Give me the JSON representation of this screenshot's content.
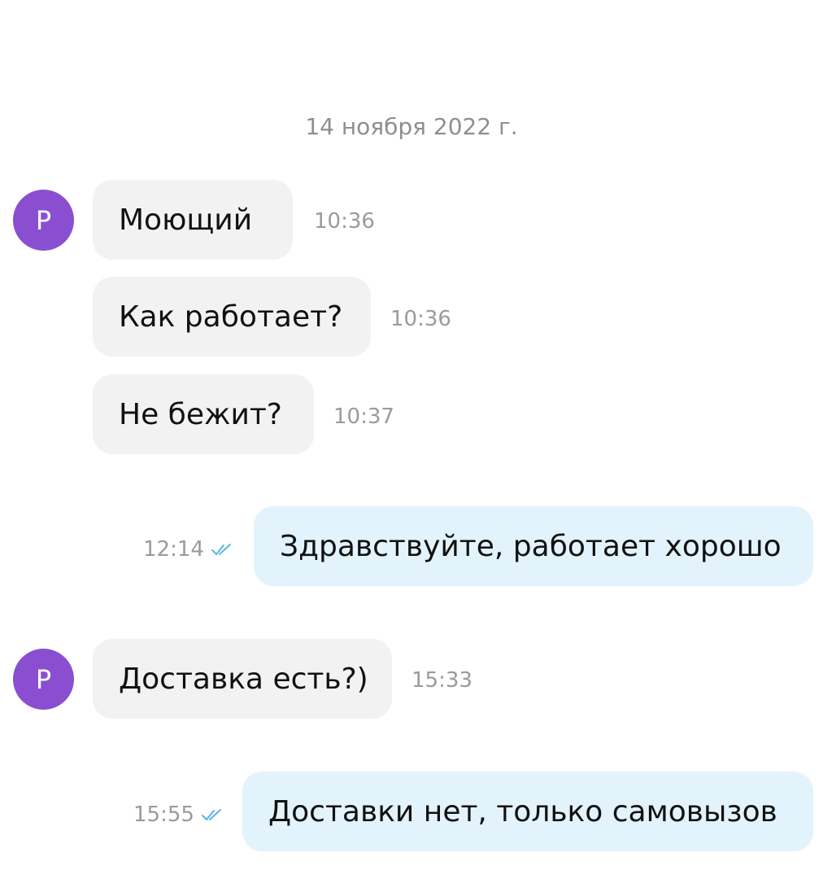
{
  "chat": {
    "date_separator": "14 ноября 2022 г.",
    "colors": {
      "avatar": "#8a4fd0",
      "incoming_bubble": "#f2f2f2",
      "outgoing_bubble": "#e3f3fb",
      "read_check": "#5ab4e5",
      "timestamp": "#9a9a9f"
    },
    "messages": [
      {
        "direction": "incoming",
        "avatar_letter": "P",
        "text": "Моющий",
        "time": "10:36"
      },
      {
        "direction": "incoming",
        "text": "Как работает?",
        "time": "10:36"
      },
      {
        "direction": "incoming",
        "text": "Не бежит?",
        "time": "10:37"
      },
      {
        "direction": "outgoing",
        "text": "Здравствуйте, работает хорошо",
        "time": "12:14",
        "status_icon": "double-check-icon"
      },
      {
        "direction": "incoming",
        "avatar_letter": "P",
        "text": "Доставка есть?)",
        "time": "15:33"
      },
      {
        "direction": "outgoing",
        "text": "Доставки нет, только самовызов",
        "time": "15:55",
        "status_icon": "double-check-icon"
      }
    ]
  }
}
